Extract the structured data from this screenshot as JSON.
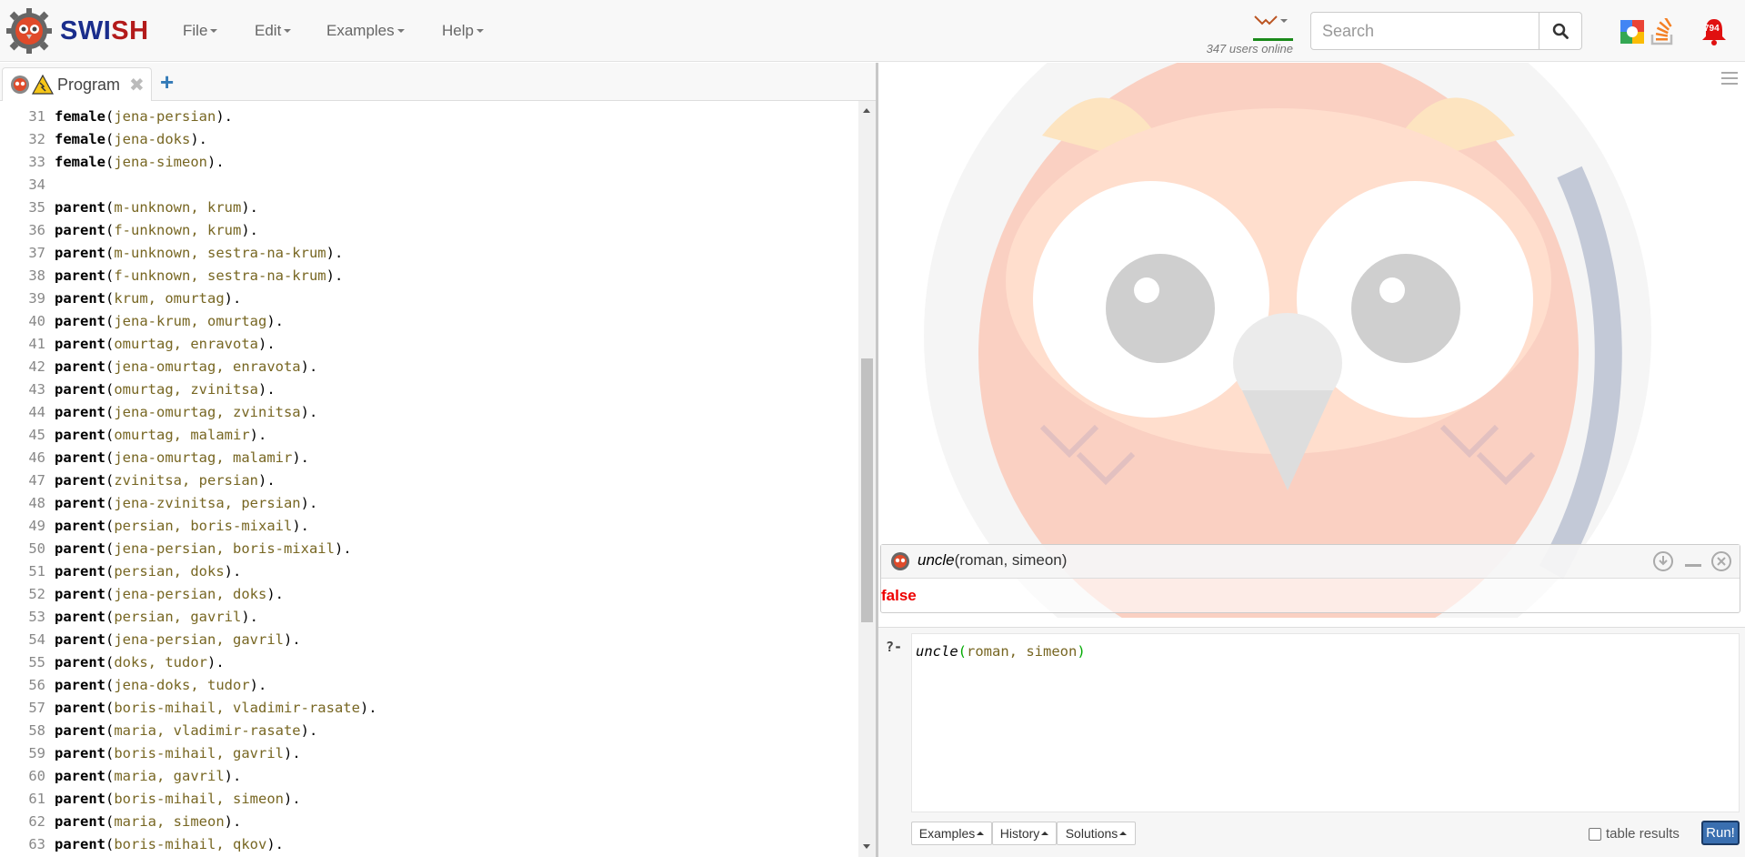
{
  "brand": {
    "name_part1": "SW",
    "name_i": "I",
    "name_part2": "SH"
  },
  "menu": {
    "file": "File",
    "edit": "Edit",
    "examples": "Examples",
    "help": "Help"
  },
  "users_online": "347 users online",
  "search": {
    "placeholder": "Search"
  },
  "notifications": {
    "count": "794"
  },
  "tab": {
    "label": "Program"
  },
  "editor": {
    "lines": [
      {
        "n": "31",
        "pred": "female",
        "args": "jena-persian"
      },
      {
        "n": "32",
        "pred": "female",
        "args": "jena-doks"
      },
      {
        "n": "33",
        "pred": "female",
        "args": "jena-simeon"
      },
      {
        "n": "34",
        "pred": "",
        "args": ""
      },
      {
        "n": "35",
        "pred": "parent",
        "args": "m-unknown, krum"
      },
      {
        "n": "36",
        "pred": "parent",
        "args": "f-unknown, krum"
      },
      {
        "n": "37",
        "pred": "parent",
        "args": "m-unknown, sestra-na-krum"
      },
      {
        "n": "38",
        "pred": "parent",
        "args": "f-unknown, sestra-na-krum"
      },
      {
        "n": "39",
        "pred": "parent",
        "args": "krum, omurtag"
      },
      {
        "n": "40",
        "pred": "parent",
        "args": "jena-krum, omurtag"
      },
      {
        "n": "41",
        "pred": "parent",
        "args": "omurtag, enravota"
      },
      {
        "n": "42",
        "pred": "parent",
        "args": "jena-omurtag, enravota"
      },
      {
        "n": "43",
        "pred": "parent",
        "args": "omurtag, zvinitsa"
      },
      {
        "n": "44",
        "pred": "parent",
        "args": "jena-omurtag, zvinitsa"
      },
      {
        "n": "45",
        "pred": "parent",
        "args": "omurtag, malamir"
      },
      {
        "n": "46",
        "pred": "parent",
        "args": "jena-omurtag, malamir"
      },
      {
        "n": "47",
        "pred": "parent",
        "args": "zvinitsa, persian"
      },
      {
        "n": "48",
        "pred": "parent",
        "args": "jena-zvinitsa, persian"
      },
      {
        "n": "49",
        "pred": "parent",
        "args": "persian, boris-mixail"
      },
      {
        "n": "50",
        "pred": "parent",
        "args": "jena-persian, boris-mixail"
      },
      {
        "n": "51",
        "pred": "parent",
        "args": "persian, doks"
      },
      {
        "n": "52",
        "pred": "parent",
        "args": "jena-persian, doks"
      },
      {
        "n": "53",
        "pred": "parent",
        "args": "persian, gavril"
      },
      {
        "n": "54",
        "pred": "parent",
        "args": "jena-persian, gavril"
      },
      {
        "n": "55",
        "pred": "parent",
        "args": "doks, tudor"
      },
      {
        "n": "56",
        "pred": "parent",
        "args": "jena-doks, tudor"
      },
      {
        "n": "57",
        "pred": "parent",
        "args": "boris-mihail, vladimir-rasate"
      },
      {
        "n": "58",
        "pred": "parent",
        "args": "maria, vladimir-rasate"
      },
      {
        "n": "59",
        "pred": "parent",
        "args": "boris-mihail, gavril"
      },
      {
        "n": "60",
        "pred": "parent",
        "args": "maria, gavril"
      },
      {
        "n": "61",
        "pred": "parent",
        "args": "boris-mihail, simeon"
      },
      {
        "n": "62",
        "pred": "parent",
        "args": "maria, simeon"
      },
      {
        "n": "63",
        "pred": "parent",
        "args": "boris-mihail, qkov"
      }
    ]
  },
  "answer": {
    "query_pred": "uncle",
    "query_args": "(roman, simeon)",
    "result": "false"
  },
  "query": {
    "prompt": "?-",
    "pred": "uncle",
    "open": "(",
    "args": "roman, simeon",
    "close": ")"
  },
  "buttons": {
    "examples": "Examples",
    "history": "History",
    "solutions": "Solutions",
    "table_results": "table results",
    "run": "Run!"
  }
}
